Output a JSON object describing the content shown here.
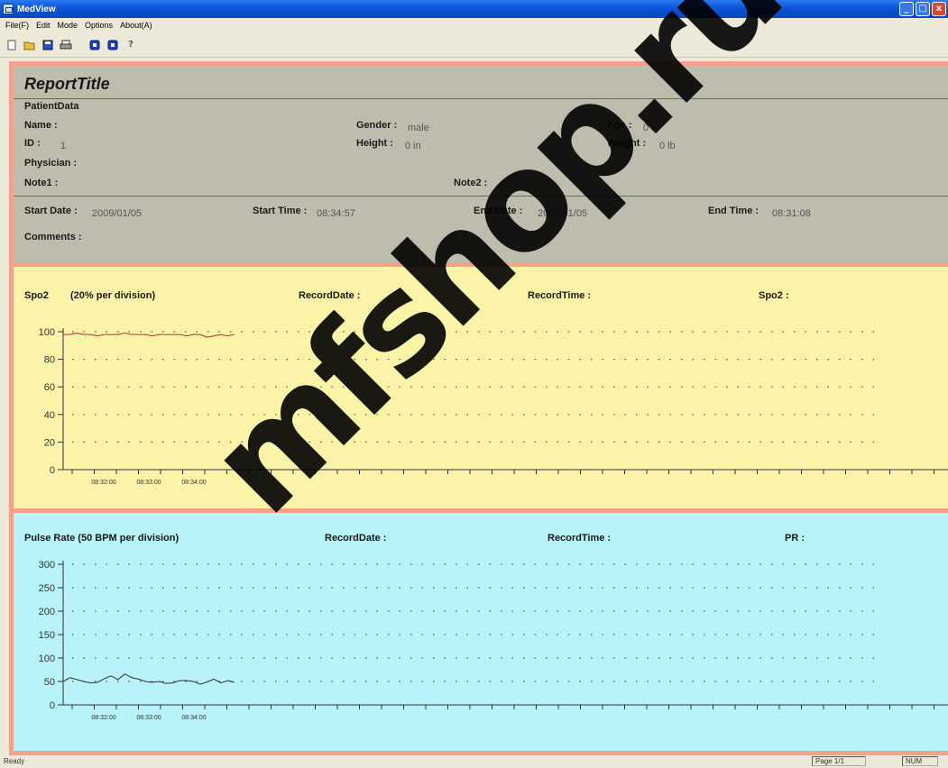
{
  "window": {
    "title": "MedView",
    "minimize": "_",
    "maximize": "□",
    "close": "x"
  },
  "menu": [
    "File(F)",
    "Edit",
    "Mode",
    "Options",
    "About(A)"
  ],
  "toolbar": [
    {
      "icon": "new-icon",
      "glyph": "▯"
    },
    {
      "icon": "open-icon",
      "glyph": "📂"
    },
    {
      "icon": "save-icon",
      "glyph": "▣"
    },
    {
      "icon": "print-icon",
      "glyph": "🖶"
    },
    {
      "icon": "record-icon",
      "glyph": "■"
    },
    {
      "icon": "stop-icon",
      "glyph": "■"
    },
    {
      "icon": "help-icon",
      "glyph": "?"
    }
  ],
  "report": {
    "title": "ReportTitle",
    "patient_data_label": "PatientData",
    "name_label": "Name :",
    "name_value": "",
    "gender_label": "Gender :",
    "gender_value": "male",
    "age_label": "Age :",
    "age_value": "0",
    "id_label": "ID :",
    "id_value": "1",
    "height_label": "Height :",
    "height_value": "0 in",
    "weight_label": "Weight :",
    "weight_value": "0 lb",
    "physician_label": "Physician :",
    "note1_label": "Note1 :",
    "note2_label": "Note2 :",
    "start_date_label": "Start Date :",
    "start_date_value": "2009/01/05",
    "start_time_label": "Start Time :",
    "start_time_value": "08:34:57",
    "end_date_label": "End Date :",
    "end_date_value": "2009/01/05",
    "end_time_label": "End Time :",
    "end_time_value": "08:31:08",
    "comments_label": "Comments :"
  },
  "spo2_panel": {
    "title": "Spo2",
    "division": "(20% per division)",
    "record_date_label": "RecordDate :",
    "record_time_label": "RecordTime :",
    "value_label": "Spo2 :",
    "bg_color": "#fbf3a8"
  },
  "pr_panel": {
    "title": "Pulse Rate (50 BPM per division)",
    "record_date_label": "RecordDate :",
    "record_time_label": "RecordTime :",
    "value_label": "PR :",
    "bg_color": "#b7f3f8"
  },
  "chart_data": [
    {
      "type": "line",
      "name": "spo2",
      "ylim": [
        0,
        100
      ],
      "yticks": [
        0,
        20,
        40,
        60,
        80,
        100
      ],
      "x_tick_labels": [
        "08:32:00",
        "08:33:00",
        "08:34:00"
      ],
      "line_color": "#b03030",
      "series": [
        {
          "values": [
            98,
            98,
            99,
            98,
            98,
            97,
            98,
            98,
            98,
            99,
            98,
            98,
            98,
            97,
            98,
            98,
            98,
            98,
            97,
            98,
            98,
            96,
            97,
            98,
            97,
            98
          ]
        }
      ]
    },
    {
      "type": "line",
      "name": "pulse_rate",
      "ylim": [
        0,
        300
      ],
      "yticks": [
        0,
        50,
        100,
        150,
        200,
        250,
        300
      ],
      "x_tick_labels": [
        "08:32:00",
        "08:33:00",
        "08:34:00"
      ],
      "line_color": "#303030",
      "series": [
        {
          "values": [
            50,
            58,
            54,
            50,
            47,
            48,
            56,
            62,
            54,
            66,
            58,
            55,
            50,
            48,
            50,
            46,
            47,
            52,
            52,
            50,
            44,
            49,
            55,
            47,
            52,
            48
          ]
        }
      ]
    }
  ],
  "status": {
    "text": "Ready",
    "page": "Page 1/1",
    "mode": "NUM"
  },
  "watermark": "mfshop.ru"
}
